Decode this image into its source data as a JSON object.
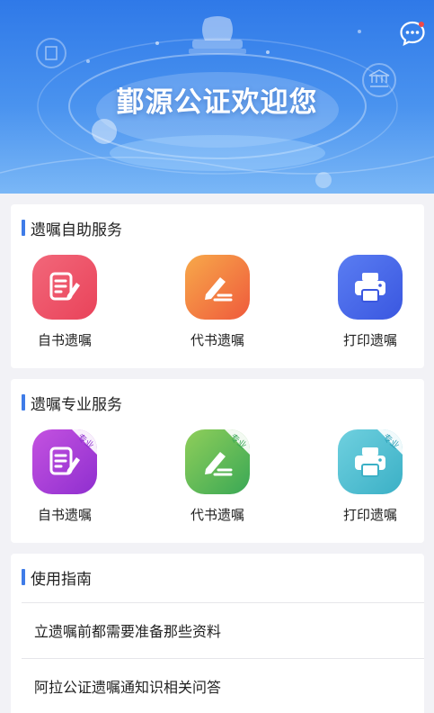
{
  "banner": {
    "title": "鄞源公证欢迎您",
    "chat_icon": "chat-bubble-icon"
  },
  "self_service": {
    "title": "遗嘱自助服务",
    "items": [
      {
        "label": "自书遗嘱",
        "icon": "document-edit-icon",
        "color_from": "#f2677a",
        "color_to": "#e9435a"
      },
      {
        "label": "代书遗嘱",
        "icon": "pen-write-icon",
        "color_from": "#f7a94a",
        "color_to": "#ef5a3c"
      },
      {
        "label": "打印遗嘱",
        "icon": "printer-icon",
        "color_from": "#5a7df2",
        "color_to": "#3a57e0"
      }
    ]
  },
  "pro_service": {
    "title": "遗嘱专业服务",
    "tag": "专业",
    "items": [
      {
        "label": "自书遗嘱",
        "icon": "document-edit-icon",
        "color_from": "#c452e0",
        "color_to": "#8f2fcf"
      },
      {
        "label": "代书遗嘱",
        "icon": "pen-write-icon",
        "color_from": "#8fce5a",
        "color_to": "#3aa855"
      },
      {
        "label": "打印遗嘱",
        "icon": "printer-icon",
        "color_from": "#6fd0df",
        "color_to": "#3bb0c6"
      }
    ]
  },
  "guide": {
    "title": "使用指南",
    "items": [
      "立遗嘱前都需要准备那些资料",
      "阿拉公证遗嘱通知识相关问答"
    ]
  },
  "colors": {
    "accent": "#3f7ce8",
    "banner_top": "#2f79e8",
    "banner_bottom": "#7ab7f6"
  }
}
